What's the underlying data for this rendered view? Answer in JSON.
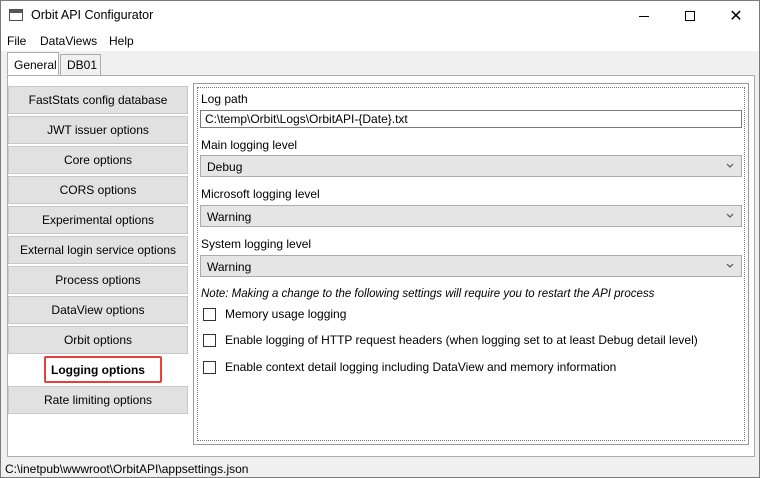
{
  "window": {
    "title": "Orbit API Configurator",
    "controls": {
      "minimize": "minimize",
      "maximize": "maximize",
      "close": "✕"
    }
  },
  "menu": [
    "File",
    "DataViews",
    "Help"
  ],
  "tabs": [
    {
      "label": "General",
      "active": true
    },
    {
      "label": "DB01",
      "active": false
    }
  ],
  "nav": [
    {
      "label": "FastStats config database",
      "selected": false
    },
    {
      "label": "JWT issuer options",
      "selected": false
    },
    {
      "label": "Core options",
      "selected": false
    },
    {
      "label": "CORS options",
      "selected": false
    },
    {
      "label": "Experimental options",
      "selected": false
    },
    {
      "label": "External login service options",
      "selected": false
    },
    {
      "label": "Process options",
      "selected": false
    },
    {
      "label": "DataView options",
      "selected": false
    },
    {
      "label": "Orbit options",
      "selected": false
    },
    {
      "label": "Logging options",
      "selected": true
    },
    {
      "label": "Rate limiting options",
      "selected": false
    }
  ],
  "logging": {
    "log_path_label": "Log path",
    "log_path_value": "C:\\temp\\Orbit\\Logs\\OrbitAPI-{Date}.txt",
    "main_level_label": "Main logging level",
    "main_level_value": "Debug",
    "microsoft_level_label": "Microsoft logging level",
    "microsoft_level_value": "Warning",
    "system_level_label": "System logging level",
    "system_level_value": "Warning",
    "note": "Note: Making a change to the following settings will require you to restart the API process",
    "checkboxes": [
      {
        "label": "Memory usage logging",
        "checked": false
      },
      {
        "label": "Enable logging of HTTP request headers (when logging set to at least Debug detail level)",
        "checked": false
      },
      {
        "label": "Enable context detail logging including DataView and memory information",
        "checked": false
      }
    ]
  },
  "status": {
    "path": "C:\\inetpub\\wwwroot\\OrbitAPI\\appsettings.json"
  },
  "colors": {
    "highlight": "#e8403a",
    "nav_button": "#e1e1e1",
    "combo": "#e5e5e5"
  }
}
